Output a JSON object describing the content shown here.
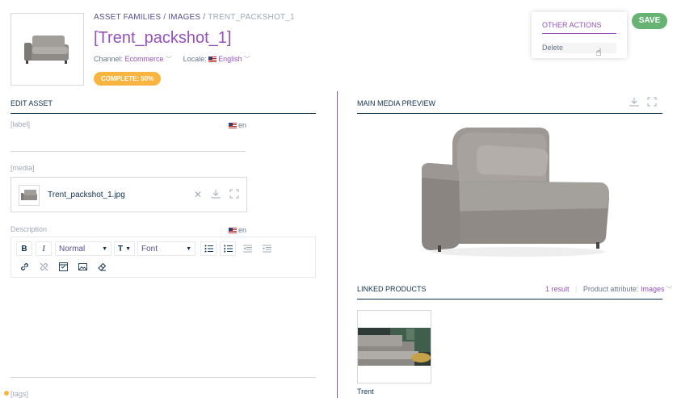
{
  "breadcrumb": {
    "asset_families": "ASSET FAMILIES",
    "images": "IMAGES",
    "current": "TRENT_PACKSHOT_1",
    "sep": "/"
  },
  "header": {
    "title": "[Trent_packshot_1]",
    "channel_label": "Channel:",
    "channel_value": "Ecommerce",
    "locale_label": "Locale:",
    "locale_value": "English",
    "completeness": "COMPLETE: 50%"
  },
  "actions_menu": {
    "header": "OTHER ACTIONS",
    "delete": "Delete"
  },
  "save_label": "SAVE",
  "edit_asset": {
    "title": "EDIT ASSET",
    "label_field": "[label]",
    "label_locale": "en",
    "media_field": "[media]",
    "media_filename": "Trent_packshot_1.jpg",
    "description_field": "Description",
    "description_locale": "en",
    "toolbar": {
      "bold": "B",
      "italic": "I",
      "block_format": "Normal",
      "text_format": "T",
      "font": "Font"
    },
    "tags_field": "[tags]"
  },
  "preview": {
    "title": "MAIN MEDIA PREVIEW"
  },
  "linked": {
    "title": "LINKED PRODUCTS",
    "count": "1 result",
    "attr_label": "Product attribute:",
    "attr_value": "Images",
    "product_name": "Trent"
  },
  "colors": {
    "accent": "#9452ba",
    "save": "#67b373",
    "badge": "#f9b53f",
    "text": "#11324d"
  },
  "icons": [
    "close-icon",
    "download-icon",
    "fullscreen-icon",
    "bold-icon",
    "italic-icon",
    "bullet-list-icon",
    "numbered-list-icon",
    "outdent-icon",
    "indent-icon",
    "link-icon",
    "unlink-icon",
    "embedded-icon",
    "image-icon",
    "eraser-icon",
    "cursor-hand-icon"
  ]
}
